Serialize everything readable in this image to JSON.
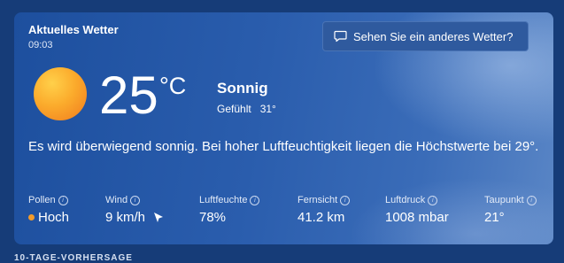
{
  "card": {
    "title": "Aktuelles Wetter",
    "time": "09:03",
    "other_weather_button": "Sehen Sie ein anderes Wetter?",
    "temperature": "25",
    "unit": "°C",
    "condition": "Sonnig",
    "feels_label": "Gefühlt",
    "feels_value": "31°",
    "description": "Es wird überwiegend sonnig. Bei hoher Luftfeuchtigkeit liegen die Höchstwerte bei 29°.",
    "metrics": [
      {
        "label": "Pollen",
        "value": "Hoch"
      },
      {
        "label": "Wind",
        "value": "9 km/h"
      },
      {
        "label": "Luftfeuchte",
        "value": "78%"
      },
      {
        "label": "Fernsicht",
        "value": "41.2 km"
      },
      {
        "label": "Luftdruck",
        "value": "1008 mbar"
      },
      {
        "label": "Taupunkt",
        "value": "21°"
      }
    ]
  },
  "next_section_heading": "10-TAGE-VORHERSAGE",
  "icons": {
    "feedback": "chat-bubble-icon",
    "condition": "sun-icon",
    "info": "info-icon",
    "pollen_level": "orange-dot",
    "wind_direction": "arrow-icon"
  },
  "colors": {
    "background": "#163c78",
    "card": "#2a5dad",
    "sun": "#fbab2c",
    "pollen_dot": "#f39b2a"
  }
}
